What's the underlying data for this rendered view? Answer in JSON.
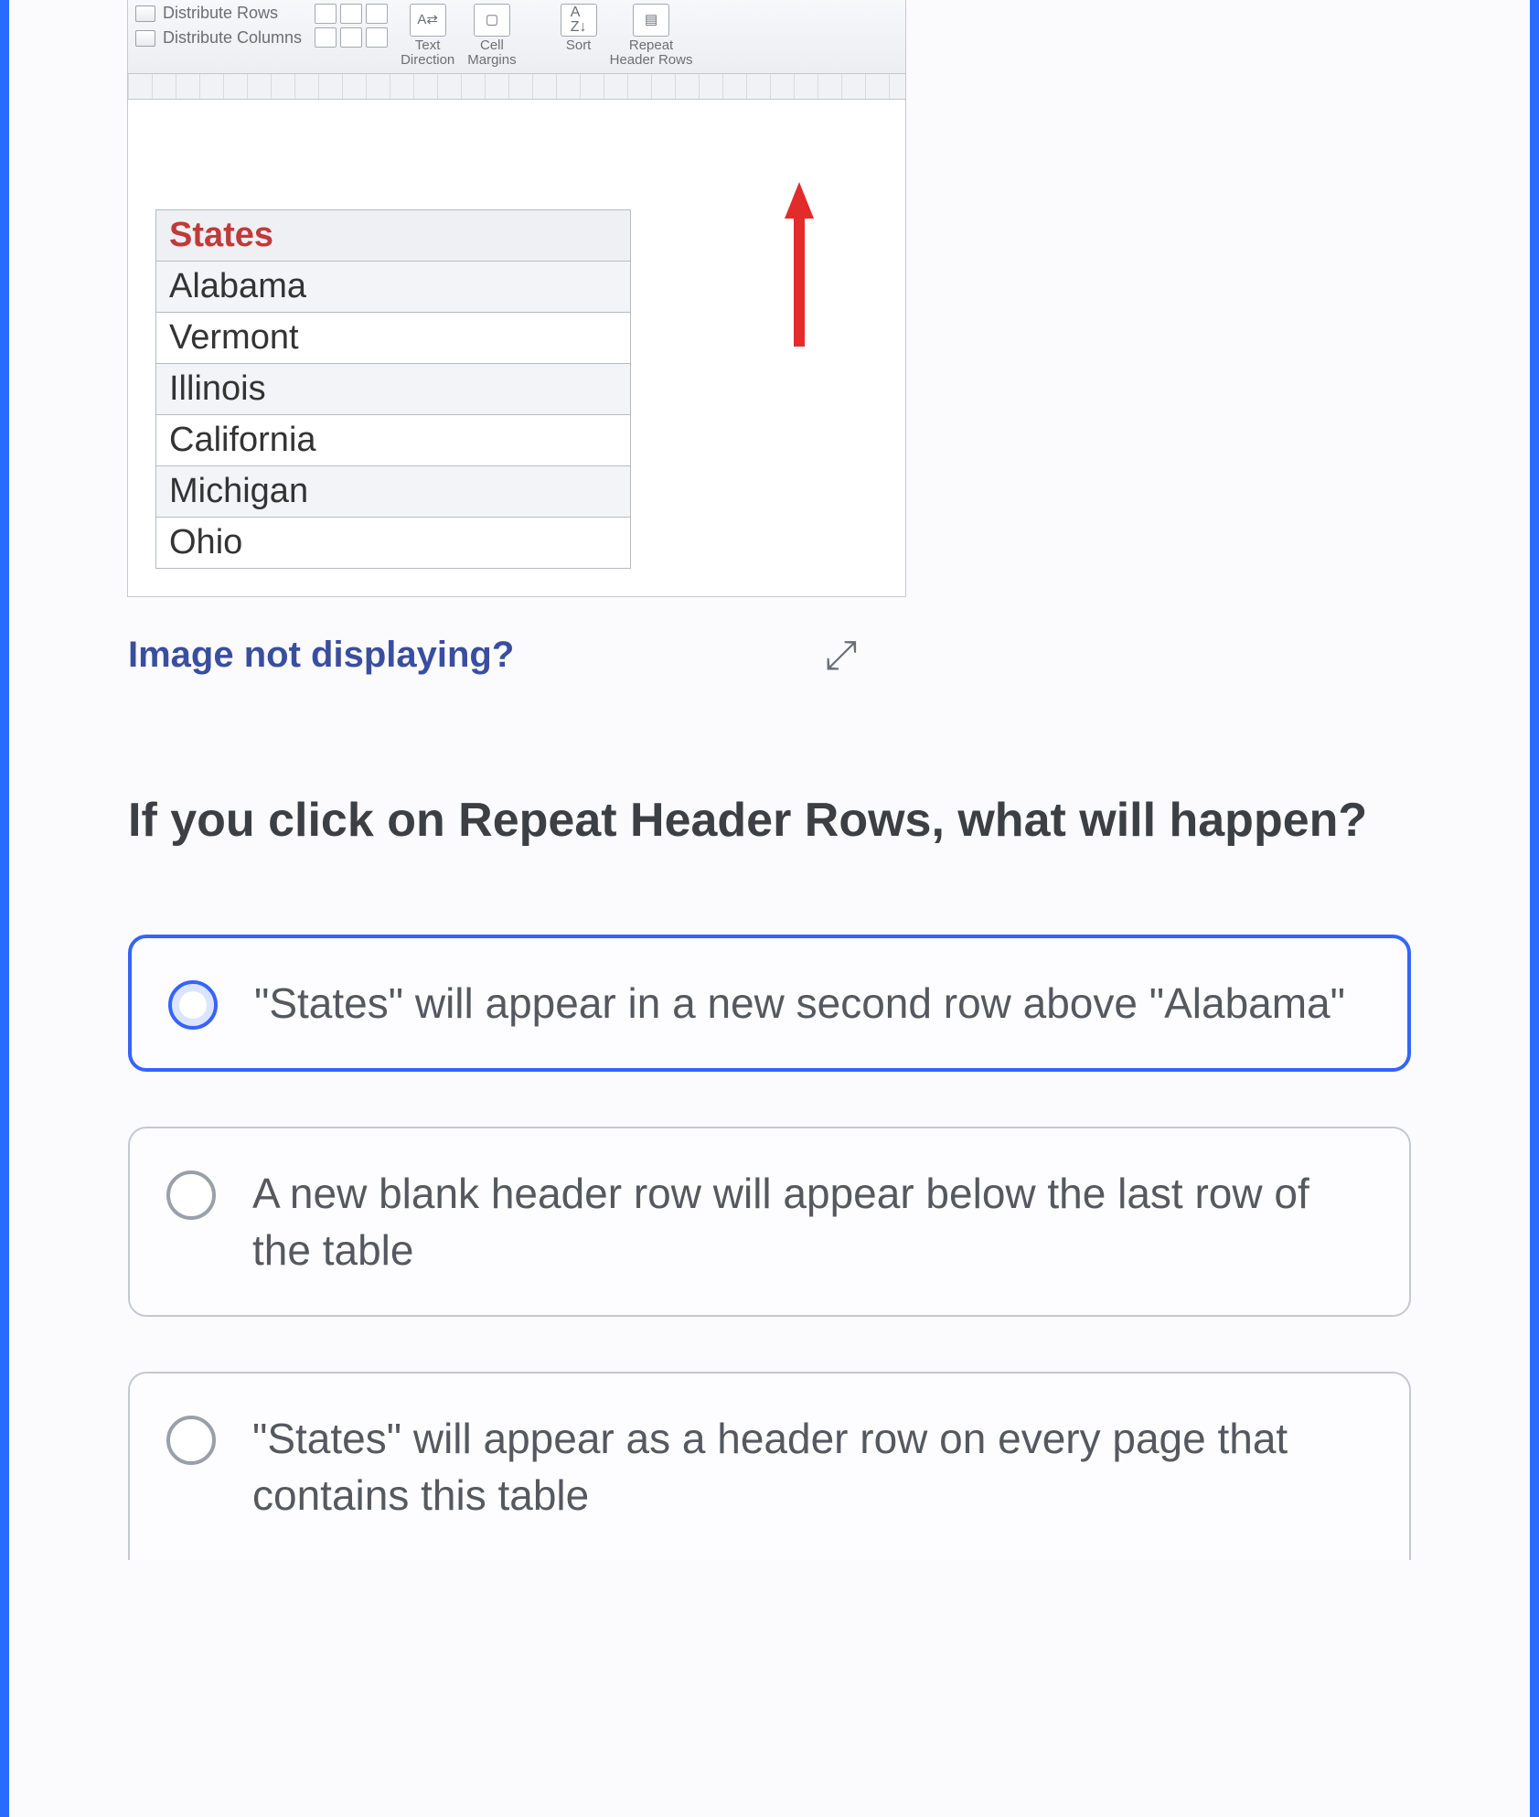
{
  "ribbon": {
    "distribute_rows": "Distribute Rows",
    "distribute_columns": "Distribute Columns",
    "text_direction": "Text\nDirection",
    "cell_margins": "Cell\nMargins",
    "sort": "Sort",
    "repeat_header_rows": "Repeat\nHeader Rows"
  },
  "table": {
    "header": "States",
    "rows": [
      "Alabama",
      "Vermont",
      "Illinois",
      "California",
      "Michigan",
      "Ohio"
    ]
  },
  "links": {
    "image_not_displaying": "Image not displaying?"
  },
  "question": "If you click on Repeat Header Rows, what will happen?",
  "options": [
    "\"States\" will appear in a new second row above \"Alabama\"",
    "A new blank header row will appear below the last row of the table",
    "\"States\" will appear as a header row on every page that contains this table"
  ],
  "selected_option_index": 0
}
